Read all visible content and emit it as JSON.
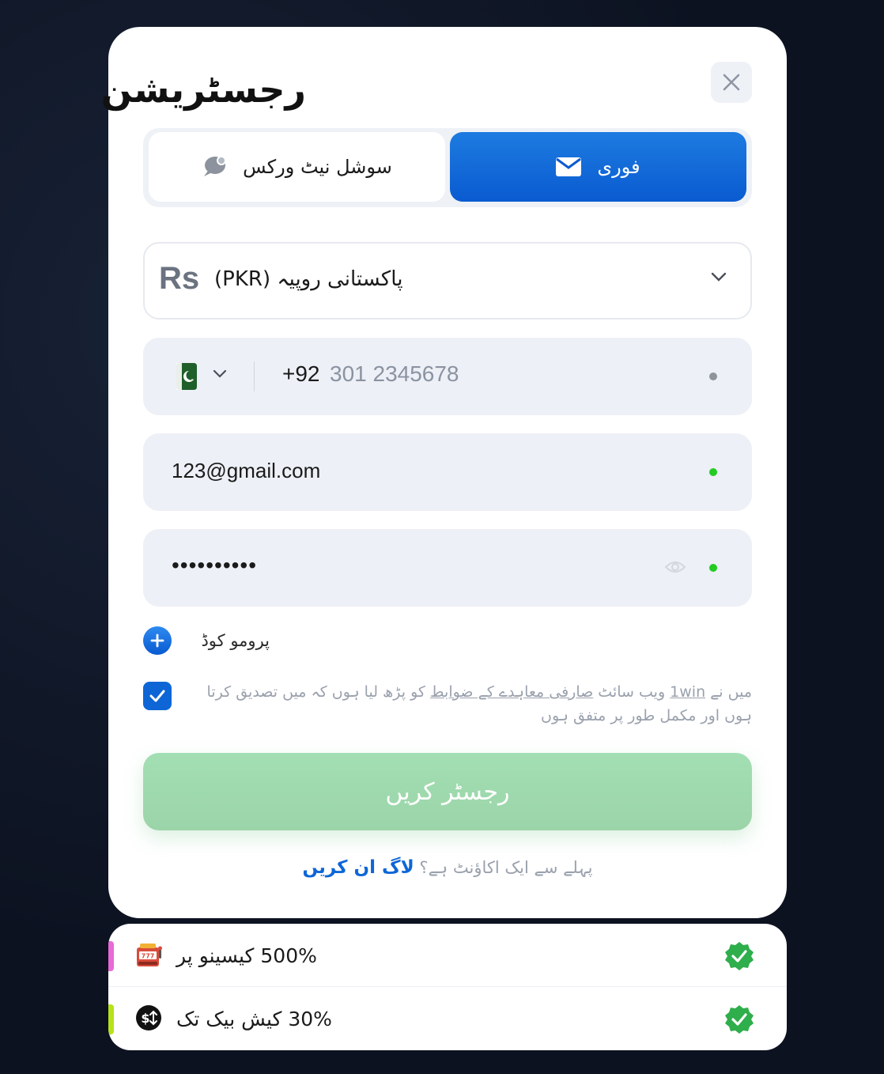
{
  "modal": {
    "title": "رجسٹریشن",
    "close_icon": "close-icon"
  },
  "tabs": [
    {
      "label": "فوری",
      "icon": "envelope-icon",
      "active": true
    },
    {
      "label": "سوشل نیٹ ورکس",
      "icon": "chat-bubbles-icon",
      "active": false
    }
  ],
  "currency": {
    "symbol": "Rs",
    "name": "(PKR) پاکستانی روپیہ"
  },
  "phone": {
    "country_flag": "pakistan-flag-icon",
    "code": "+92",
    "placeholder": "301 2345678",
    "status_color": "#8e949c"
  },
  "email": {
    "value": "123@gmail.com",
    "status_color": "#22cc22"
  },
  "password": {
    "value": "••••••••••",
    "status_color": "#22cc22"
  },
  "promo": {
    "label": "پرومو کوڈ"
  },
  "terms": {
    "checked": true,
    "text_prefix": "میں نے ",
    "link_1": "1win",
    "text_middle": " ویب سائٹ ",
    "link_2": "صارفی معاہدے کے ضوابط",
    "text_suffix": " کو پڑھ لیا ہوں کہ میں تصدیق کرتا ہوں اور مکمل طور پر متفق ہوں"
  },
  "register_button": {
    "label": "رجسٹر کریں"
  },
  "login": {
    "prompt": "پہلے سے ایک اکاؤنٹ ہے؟",
    "link": "لاگ ان کریں"
  },
  "bonuses": [
    {
      "text": "500% کیسینو پر",
      "icon": "slot-machine-icon",
      "stripe_color": "#e86ad8"
    },
    {
      "text": "30% کیش بیک تک",
      "icon": "cashback-icon",
      "stripe_color": "#b6e21a"
    }
  ],
  "colors": {
    "accent_blue": "#0e66d6",
    "register_green": "#9fdcb0",
    "check_green": "#2fae4c"
  }
}
